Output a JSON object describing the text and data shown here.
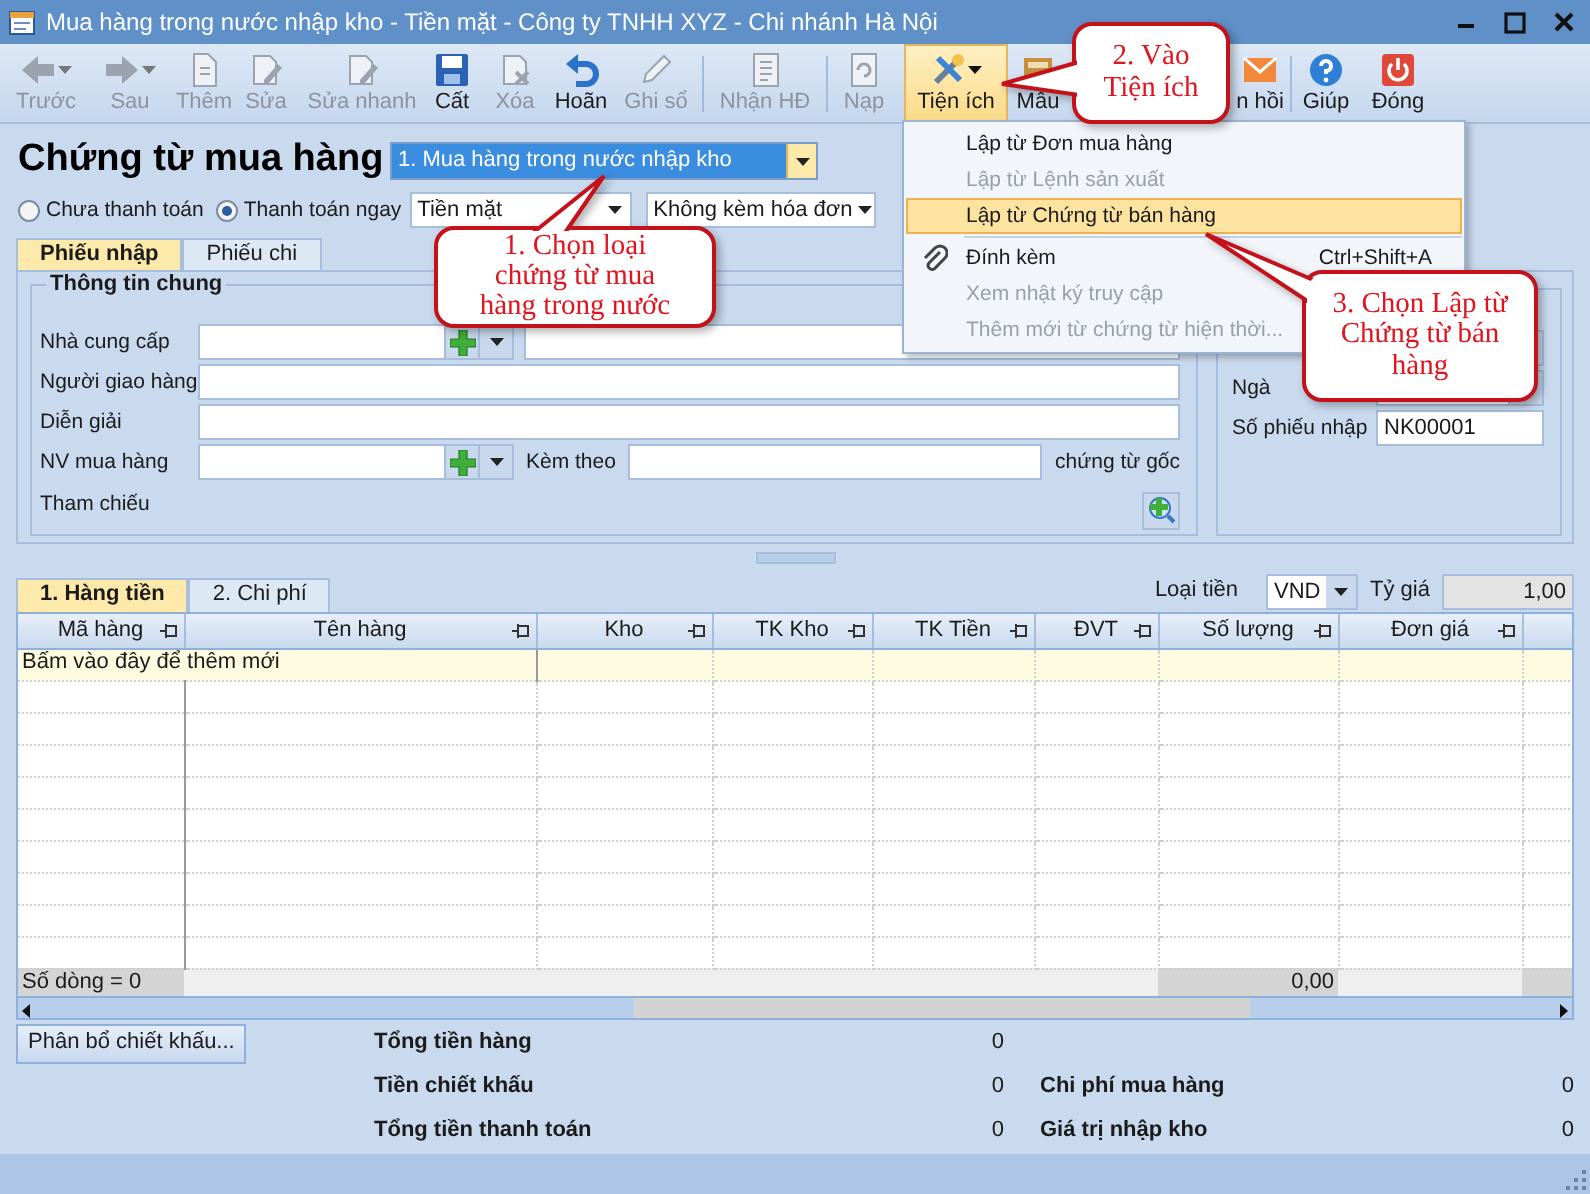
{
  "window": {
    "title": "Mua hàng trong nước nhập kho - Tiền mặt - Công ty TNHH XYZ - Chi nhánh Hà Nội"
  },
  "toolbar": [
    {
      "label": "Trước",
      "disabled": true,
      "has_menu": true,
      "expanded": false
    },
    {
      "label": "Sau",
      "disabled": true,
      "has_menu": true,
      "expanded": false
    },
    {
      "label": "Thêm",
      "disabled": true,
      "has_menu": false,
      "expanded": false
    },
    {
      "label": "Sửa",
      "disabled": true,
      "has_menu": false,
      "expanded": false
    },
    {
      "label": "Sửa nhanh",
      "disabled": true,
      "has_menu": false,
      "expanded": false
    },
    {
      "label": "Cất",
      "disabled": false,
      "has_menu": false,
      "expanded": false
    },
    {
      "label": "Xóa",
      "disabled": true,
      "has_menu": false,
      "expanded": false
    },
    {
      "label": "Hoãn",
      "disabled": false,
      "has_menu": false,
      "expanded": false
    },
    {
      "label": "Ghi sổ",
      "disabled": true,
      "has_menu": false,
      "expanded": false
    },
    {
      "label": "Nhận HĐ",
      "disabled": true,
      "has_menu": false,
      "expanded": false
    },
    {
      "label": "Nạp",
      "disabled": true,
      "has_menu": false,
      "expanded": false
    },
    {
      "label": "Tiện ích",
      "disabled": false,
      "has_menu": true,
      "expanded": true
    },
    {
      "label": "Mẫu",
      "disabled": false,
      "has_menu": false,
      "expanded": false
    },
    {
      "label": "n hồi",
      "disabled": false,
      "has_menu": false,
      "expanded": false
    },
    {
      "label": "Giúp",
      "disabled": false,
      "has_menu": false,
      "expanded": false
    },
    {
      "label": "Đóng",
      "disabled": false,
      "has_menu": false,
      "expanded": false
    }
  ],
  "header": {
    "title": "Chứng từ mua hàng",
    "voucher_type": "1. Mua hàng trong nước nhập kho",
    "payment_options": [
      {
        "label": "Chưa thanh toán",
        "selected": false
      },
      {
        "label": "Thanh toán ngay",
        "selected": true
      }
    ],
    "payment_method": "Tiền mặt",
    "invoice_option": "Không kèm hóa đơn"
  },
  "form_tabs": [
    {
      "label": "Phiếu nhập",
      "selected": true
    },
    {
      "label": "Phiếu chi",
      "selected": false
    }
  ],
  "general_info": {
    "title": "Thông tin chung",
    "rows": [
      {
        "label": "Nhà cung cấp",
        "kind": "lookup_pair"
      },
      {
        "label": "Người giao hàng",
        "kind": "text"
      },
      {
        "label": "Diễn giải",
        "kind": "text"
      },
      {
        "label": "NV mua hàng",
        "kind": "lookup_attach",
        "attach_label": "Kèm theo",
        "attach_suffix": "chứng từ gốc"
      },
      {
        "label": "Tham chiếu",
        "kind": "reference"
      }
    ]
  },
  "voucher_info": {
    "rows": [
      {
        "kind": "combo"
      },
      {
        "kind": "date",
        "label": "Ngà"
      },
      {
        "kind": "text",
        "label": "Số phiếu nhập",
        "value": "NK00001"
      }
    ]
  },
  "grid_tabs": [
    {
      "label": "1. Hàng tiền",
      "selected": true
    },
    {
      "label": "2. Chi phí",
      "selected": false
    }
  ],
  "currency": {
    "label": "Loại tiền",
    "value": "VND"
  },
  "exchange_rate": {
    "label": "Tỷ giá",
    "value": "1,00"
  },
  "grid": {
    "columns": [
      "Mã hàng",
      "Tên hàng",
      "Kho",
      "TK Kho",
      "TK Tiền",
      "ĐVT",
      "Số lượng",
      "Đơn giá"
    ],
    "new_row_hint": "Bấm vào đây để thêm mới",
    "footer": {
      "row_count": "Số dòng = 0",
      "quantity_total": "0,00"
    }
  },
  "discount_button": "Phân bổ chiết khấu...",
  "totals_left": [
    {
      "label": "Tổng tiền hàng",
      "value": "0"
    },
    {
      "label": "Tiền chiết khấu",
      "value": "0"
    },
    {
      "label": "Tổng tiền thanh toán",
      "value": "0"
    }
  ],
  "totals_right": [
    {
      "label": "Chi phí mua hàng",
      "value": "0"
    },
    {
      "label": "Giá trị nhập kho",
      "value": "0"
    }
  ],
  "utility_menu": {
    "items": [
      {
        "kind": "item",
        "label": "Lập từ Đơn mua hàng",
        "disabled": false,
        "selected": false
      },
      {
        "kind": "item",
        "label": "Lập từ Lệnh sản xuất",
        "disabled": true,
        "selected": false
      },
      {
        "kind": "item",
        "label": "Lập từ Chứng từ bán hàng",
        "disabled": false,
        "selected": true
      },
      {
        "kind": "separator"
      },
      {
        "kind": "attach",
        "label": "Đính kèm",
        "shortcut": "Ctrl+Shift+A",
        "disabled": false,
        "selected": false
      },
      {
        "kind": "item",
        "label": "Xem nhật ký truy cập",
        "disabled": true,
        "selected": false
      },
      {
        "kind": "item",
        "label": "Thêm mới từ chứng từ hiện thời...",
        "disabled": true,
        "selected": false
      }
    ]
  },
  "callouts": [
    {
      "text": "1. Chọn loại chứng từ mua hàng trong nước"
    },
    {
      "text": "2. Vào Tiện ích"
    },
    {
      "text": "3. Chọn Lập từ Chứng từ bán hàng"
    }
  ]
}
